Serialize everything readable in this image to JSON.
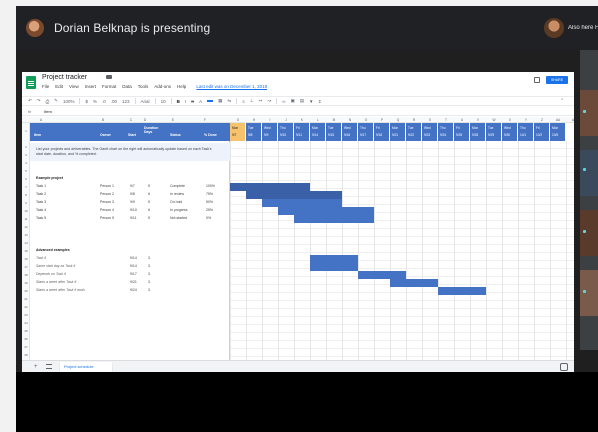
{
  "meet": {
    "presenter_text": "Dorian Belknap is presenting",
    "also_here_text": "Also here Fiiss Ln"
  },
  "sheets": {
    "title": "Project tracker",
    "menu": [
      "File",
      "Edit",
      "View",
      "Insert",
      "Format",
      "Data",
      "Tools",
      "Add-ons",
      "Help"
    ],
    "last_edit": "Last edit was on December 1, 2018",
    "share_label": "SHARE",
    "toolbar": [
      "100%",
      "$",
      "%",
      ".0",
      ".00",
      "123",
      "Arial",
      "10"
    ],
    "formula_label": "fx",
    "formula_value": "Item",
    "col_letters": [
      "A",
      "B",
      "C",
      "D",
      "E",
      "F",
      "G",
      "H",
      "I",
      "J",
      "K",
      "L",
      "M",
      "N",
      "O",
      "P",
      "Q",
      "R",
      "S",
      "T",
      "U",
      "V",
      "W",
      "X",
      "Y",
      "Z",
      "AA",
      "AB"
    ],
    "headers": {
      "item": "Item",
      "owner": "Owner",
      "start": "Start",
      "duration": "Duration Days",
      "status": "Status",
      "done": "% Done"
    },
    "date_headers": [
      {
        "day": "Mon",
        "date": "9/7"
      },
      {
        "day": "Tue",
        "date": "9/8"
      },
      {
        "day": "Wed",
        "date": "9/9"
      },
      {
        "day": "Thu",
        "date": "9/10"
      },
      {
        "day": "Fri",
        "date": "9/11"
      },
      {
        "day": "Mon",
        "date": "9/14"
      },
      {
        "day": "Tue",
        "date": "9/15"
      },
      {
        "day": "Wed",
        "date": "9/16"
      },
      {
        "day": "Thu",
        "date": "9/17"
      },
      {
        "day": "Fri",
        "date": "9/18"
      },
      {
        "day": "Mon",
        "date": "9/21"
      },
      {
        "day": "Tue",
        "date": "9/22"
      },
      {
        "day": "Wed",
        "date": "9/23"
      },
      {
        "day": "Thu",
        "date": "9/24"
      },
      {
        "day": "Fri",
        "date": "9/25"
      },
      {
        "day": "Mon",
        "date": "9/28"
      },
      {
        "day": "Tue",
        "date": "9/29"
      },
      {
        "day": "Wed",
        "date": "9/30"
      },
      {
        "day": "Thu",
        "date": "10/1"
      },
      {
        "day": "Fri",
        "date": "10/2"
      },
      {
        "day": "Mon",
        "date": "10/5"
      }
    ],
    "instructions": "List your projects and deliverables. The Gantt chart on the right will automatically update based on each Task's start date, duration, and % completed.",
    "section1": "Example project",
    "tasks": [
      {
        "item": "Task 1",
        "owner": "Person 1",
        "start": "9/7",
        "dur": "5",
        "status": "Complete",
        "done": "100%"
      },
      {
        "item": "Task 2",
        "owner": "Person 2",
        "start": "9/8",
        "dur": "6",
        "status": "In review",
        "done": "75%"
      },
      {
        "item": "Task 3",
        "owner": "Person 3",
        "start": "9/9",
        "dur": "5",
        "status": "On hold",
        "done": "50%"
      },
      {
        "item": "Task 4",
        "owner": "Person 4",
        "start": "9/10",
        "dur": "6",
        "status": "In progress",
        "done": "25%"
      },
      {
        "item": "Task 5",
        "owner": "Person 5",
        "start": "9/11",
        "dur": "5",
        "status": "Not started",
        "done": "0%"
      }
    ],
    "section2": "Advanced examples",
    "advanced": [
      {
        "item": "Task 6",
        "start": "9/14",
        "dur": "3"
      },
      {
        "item": "Same start day as Task 6",
        "start": "9/14",
        "dur": "3"
      },
      {
        "item": "Depends on Task 6",
        "start": "9/17",
        "dur": "3"
      },
      {
        "item": "Starts a week after Task 6",
        "start": "9/21",
        "dur": "3"
      },
      {
        "item": "Starts a week after Task 6 ends",
        "start": "9/24",
        "dur": "3"
      }
    ],
    "sheet_tab": "Project schedule"
  }
}
